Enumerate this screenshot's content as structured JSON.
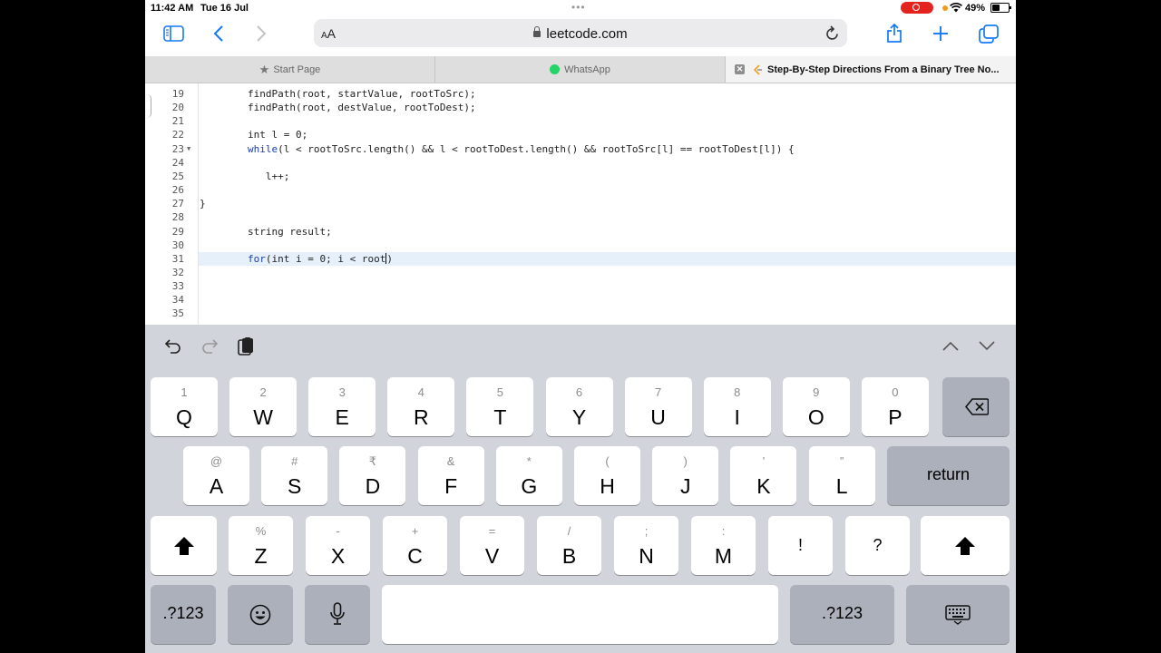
{
  "status": {
    "time": "11:42 AM",
    "date": "Tue 16 Jul",
    "battery": "49%"
  },
  "toolbar": {
    "reader_label_small": "A",
    "reader_label_big": "A",
    "url": "leetcode.com"
  },
  "tabs": [
    {
      "label": "Start Page",
      "icon": "star-icon"
    },
    {
      "label": "WhatsApp",
      "icon": "whatsapp-icon"
    },
    {
      "label": "Step-By-Step Directions From a Binary Tree No...",
      "icon": "leetcode-icon",
      "active": true
    }
  ],
  "editor": {
    "lines": [
      {
        "num": "19",
        "parts": [
          {
            "t": "        findPath(root, startValue, rootToSrc);"
          }
        ]
      },
      {
        "num": "20",
        "parts": [
          {
            "t": "        findPath(root, destValue, rootToDest);"
          }
        ]
      },
      {
        "num": "21",
        "parts": []
      },
      {
        "num": "22",
        "parts": [
          {
            "t": "        int l = 0;"
          }
        ]
      },
      {
        "num": "23",
        "fold": true,
        "parts": [
          {
            "t": "        "
          },
          {
            "t": "while",
            "kw": true
          },
          {
            "t": "(l < rootToSrc.length() && l < rootToDest.length() && rootToSrc[l] == rootToDest[l]) {"
          }
        ]
      },
      {
        "num": "24",
        "parts": []
      },
      {
        "num": "25",
        "parts": [
          {
            "t": "           l++;"
          }
        ]
      },
      {
        "num": "26",
        "parts": []
      },
      {
        "num": "27",
        "parts": [
          {
            "t": "}"
          }
        ]
      },
      {
        "num": "28",
        "parts": []
      },
      {
        "num": "29",
        "parts": [
          {
            "t": "        string result;"
          }
        ]
      },
      {
        "num": "30",
        "parts": []
      },
      {
        "num": "31",
        "active": true,
        "parts": [
          {
            "t": "        "
          },
          {
            "t": "for",
            "kw": true
          },
          {
            "t": "(int i = 0; i < root"
          }
        ],
        "cursor": true,
        "after": ")"
      },
      {
        "num": "32",
        "parts": []
      },
      {
        "num": "33",
        "parts": []
      },
      {
        "num": "34",
        "parts": []
      },
      {
        "num": "35",
        "parts": []
      }
    ]
  },
  "keyboard": {
    "row1": [
      {
        "hint": "1",
        "key": "Q"
      },
      {
        "hint": "2",
        "key": "W"
      },
      {
        "hint": "3",
        "key": "E"
      },
      {
        "hint": "4",
        "key": "R"
      },
      {
        "hint": "5",
        "key": "T"
      },
      {
        "hint": "6",
        "key": "Y"
      },
      {
        "hint": "7",
        "key": "U"
      },
      {
        "hint": "8",
        "key": "I"
      },
      {
        "hint": "9",
        "key": "O"
      },
      {
        "hint": "0",
        "key": "P"
      }
    ],
    "row2": [
      {
        "hint": "@",
        "key": "A"
      },
      {
        "hint": "#",
        "key": "S"
      },
      {
        "hint": "₹",
        "key": "D"
      },
      {
        "hint": "&",
        "key": "F"
      },
      {
        "hint": "*",
        "key": "G"
      },
      {
        "hint": "(",
        "key": "H"
      },
      {
        "hint": ")",
        "key": "J"
      },
      {
        "hint": "’",
        "key": "K"
      },
      {
        "hint": "”",
        "key": "L"
      }
    ],
    "row3": [
      {
        "hint": "%",
        "key": "Z"
      },
      {
        "hint": "-",
        "key": "X"
      },
      {
        "hint": "+",
        "key": "C"
      },
      {
        "hint": "=",
        "key": "V"
      },
      {
        "hint": "/",
        "key": "B"
      },
      {
        "hint": ";",
        "key": "N"
      },
      {
        "hint": ":",
        "key": "M"
      },
      {
        "hint": "",
        "key": "!"
      },
      {
        "hint": "",
        "key": "?"
      }
    ],
    "return_label": "return",
    "numbers_label": ".?123"
  }
}
